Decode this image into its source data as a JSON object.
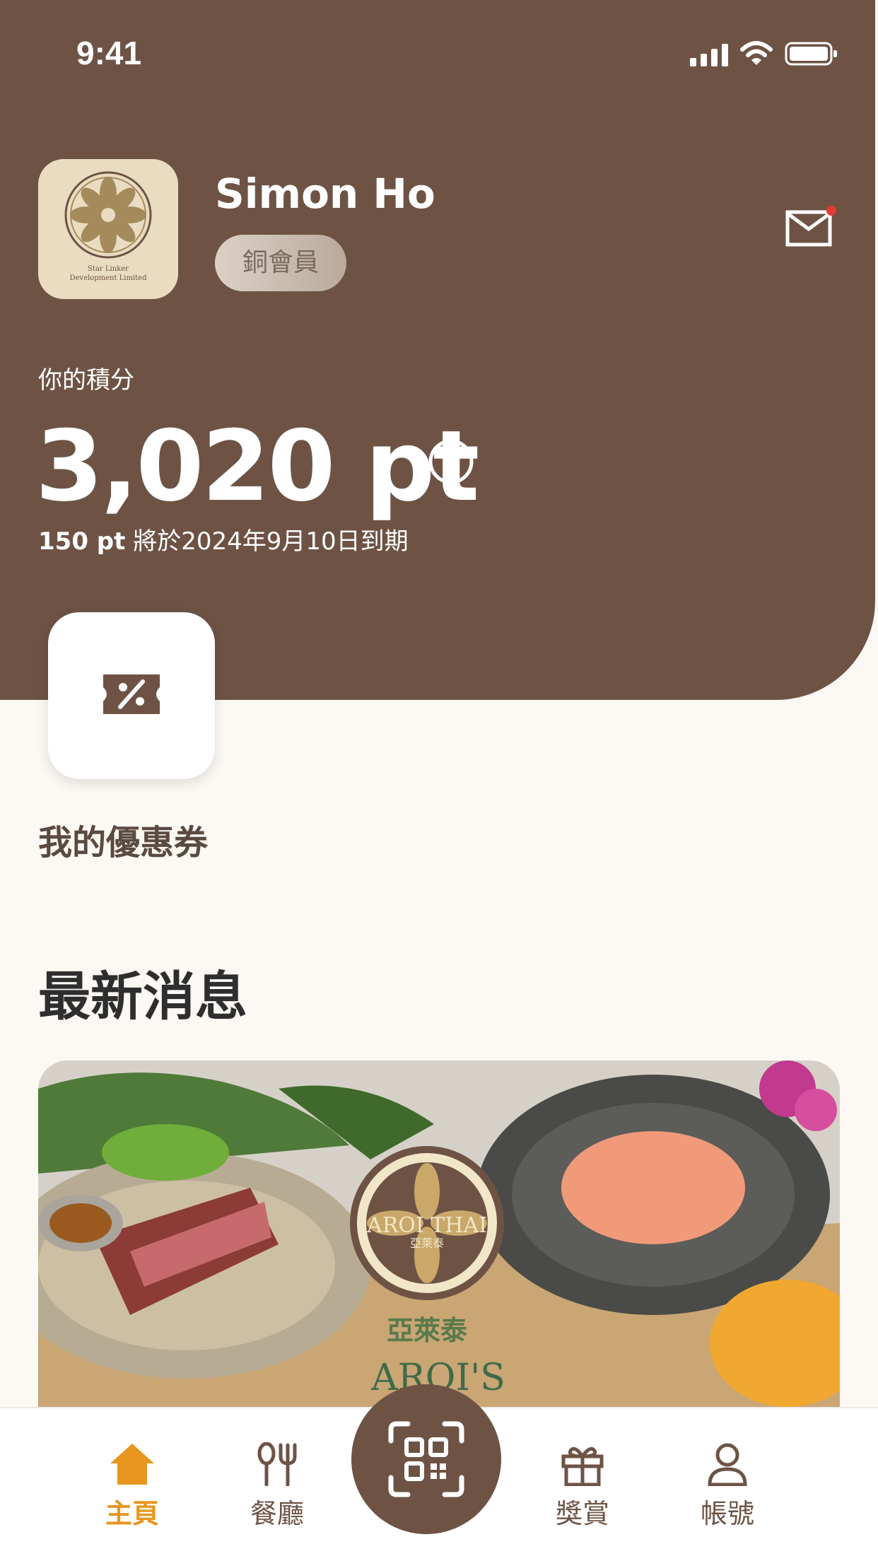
{
  "status_bar": {
    "time": "9:41",
    "icons": [
      "signal-icon",
      "wifi-icon",
      "battery-icon"
    ]
  },
  "header": {
    "avatar": {
      "icon": "lotus-logo-icon",
      "caption_line1": "Star Linker",
      "caption_line2": "Development Limited"
    },
    "user_name": "Simon Ho",
    "tier": "銅會員",
    "mail_icon": "mail-icon",
    "points_label": "你的積分",
    "points_value": "3,020 pt",
    "expiry_points": "150 pt",
    "expiry_text": " 將於2024年9月10日到期"
  },
  "coupons": {
    "icon": "ticket-percent-icon",
    "label": "我的優惠券"
  },
  "news": {
    "title": "最新消息",
    "banner_logo_text": "AROI THAI",
    "banner_logo_subtext": "亞萊泰",
    "banner_chinese": "亞萊泰",
    "banner_english": "AROI'S"
  },
  "bottom_nav": {
    "items": [
      {
        "label": "主頁",
        "icon": "home-icon"
      },
      {
        "label": "餐廳",
        "icon": "cutlery-icon"
      },
      {
        "label": "",
        "icon": "qr-scan-icon"
      },
      {
        "label": "獎賞",
        "icon": "gift-icon"
      },
      {
        "label": "帳號",
        "icon": "user-icon"
      }
    ]
  },
  "colors": {
    "header_brown": "#6e5345",
    "accent_orange": "#e7961e",
    "background": "#fcf8f4"
  }
}
